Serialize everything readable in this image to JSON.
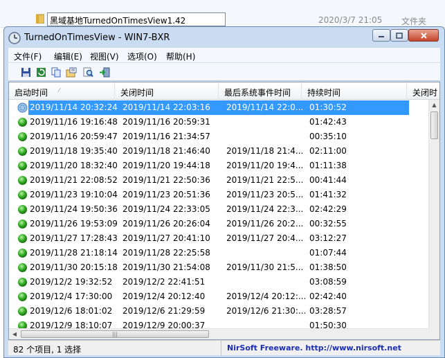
{
  "background": {
    "file_name": "黑域基地TurnedOnTimesView1.42",
    "file_date": "2020/3/7 21:05",
    "file_type": "文件夹"
  },
  "window": {
    "title": "TurnedOnTimesView  -  WIN7-BXR",
    "icon": "app-clock-icon"
  },
  "menu": {
    "file": "文件(F)",
    "edit": "编辑(E)",
    "view": "视图(V)",
    "options": "选项(O)",
    "help": "帮助(H)"
  },
  "toolbar": {
    "icons": [
      "save-icon",
      "refresh-icon",
      "copy-icon",
      "properties-icon",
      "find-icon",
      "exit-icon"
    ]
  },
  "columns": [
    "启动时间",
    "关闭时间",
    "最后系统事件时间",
    "持续时间",
    "关闭时"
  ],
  "rows": [
    {
      "start": "2019/11/14 20:32:24",
      "end": "2019/11/14 22:03:16",
      "last": "2019/11/14 22:0...",
      "dur": "01:30:52",
      "selected": true
    },
    {
      "start": "2019/11/16 19:16:48",
      "end": "2019/11/16 20:59:31",
      "last": "",
      "dur": "01:42:43"
    },
    {
      "start": "2019/11/16 20:59:47",
      "end": "2019/11/16 21:34:57",
      "last": "",
      "dur": "00:35:10"
    },
    {
      "start": "2019/11/18 19:35:40",
      "end": "2019/11/18 21:46:40",
      "last": "2019/11/18 21:4...",
      "dur": "02:11:00"
    },
    {
      "start": "2019/11/20 18:32:40",
      "end": "2019/11/20 19:44:18",
      "last": "2019/11/20 19:4...",
      "dur": "01:11:38"
    },
    {
      "start": "2019/11/21 22:08:52",
      "end": "2019/11/21 22:50:36",
      "last": "2019/11/21 22:5...",
      "dur": "00:41:44"
    },
    {
      "start": "2019/11/23 19:10:04",
      "end": "2019/11/23 20:51:36",
      "last": "2019/11/23 20:5...",
      "dur": "01:41:32"
    },
    {
      "start": "2019/11/24 19:50:36",
      "end": "2019/11/24 22:33:05",
      "last": "2019/11/24 22:3...",
      "dur": "02:42:29"
    },
    {
      "start": "2019/11/26 19:53:09",
      "end": "2019/11/26 20:26:04",
      "last": "2019/11/26 20:2...",
      "dur": "00:32:55"
    },
    {
      "start": "2019/11/27 17:28:43",
      "end": "2019/11/27 20:41:10",
      "last": "2019/11/27 20:4...",
      "dur": "03:12:27"
    },
    {
      "start": "2019/11/28 21:18:14",
      "end": "2019/11/28 22:25:58",
      "last": "",
      "dur": "01:07:44"
    },
    {
      "start": "2019/11/30 20:15:18",
      "end": "2019/11/30 21:54:08",
      "last": "2019/11/30 21:5...",
      "dur": "01:38:50"
    },
    {
      "start": "2019/12/2 19:32:52",
      "end": "2019/12/2 22:41:51",
      "last": "",
      "dur": "03:08:59"
    },
    {
      "start": "2019/12/4 17:30:00",
      "end": "2019/12/4 20:12:40",
      "last": "2019/12/4 20:12:...",
      "dur": "02:42:40"
    },
    {
      "start": "2019/12/6 18:01:02",
      "end": "2019/12/6 21:29:59",
      "last": "2019/12/6 21:30:...",
      "dur": "03:28:57"
    },
    {
      "start": "2019/12/9 18:10:07",
      "end": "2019/12/9 20:00:37",
      "last": "",
      "dur": "01:50:30"
    }
  ],
  "status": {
    "count": "82 个项目, 1 选择",
    "link": "NirSoft Freeware.  http://www.nirsoft.net"
  },
  "colors": {
    "selection": "#3399ff",
    "status_dot": "#2eaa1f",
    "link": "#1a2db0"
  }
}
